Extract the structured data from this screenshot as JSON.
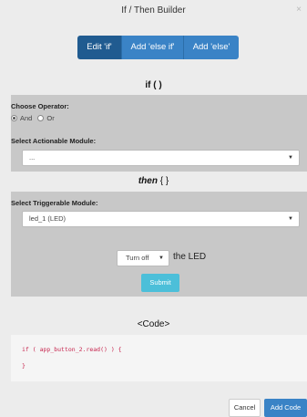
{
  "dialog": {
    "title": "If / Then Builder",
    "close_glyph": "×"
  },
  "tabs": [
    {
      "label": "Edit 'if'",
      "active": true
    },
    {
      "label": "Add 'else if'",
      "active": false
    },
    {
      "label": "Add 'else'",
      "active": false
    }
  ],
  "if_section": {
    "heading": "if ( )",
    "operator_label": "Choose Operator:",
    "operators": [
      {
        "label": "And",
        "checked": true
      },
      {
        "label": "Or",
        "checked": false
      }
    ],
    "actionable_label": "Select Actionable Module:",
    "actionable_value": "..."
  },
  "then_section": {
    "heading_main": "then",
    "heading_braces": "{ }",
    "triggerable_label": "Select Triggerable Module:",
    "triggerable_value": "led_1 (LED)",
    "action_value": "Turn off",
    "action_suffix": "the LED",
    "submit_label": "Submit"
  },
  "code_section": {
    "heading": "<Code>",
    "lines": [
      "if ( app_button_2.read() ) {",
      "}"
    ]
  },
  "footer": {
    "cancel_label": "Cancel",
    "add_code_label": "Add Code"
  },
  "colors": {
    "tab": "#3a83c6",
    "tab_active": "#205b90",
    "submit": "#4cbfd9",
    "code_text": "#c7254e"
  }
}
